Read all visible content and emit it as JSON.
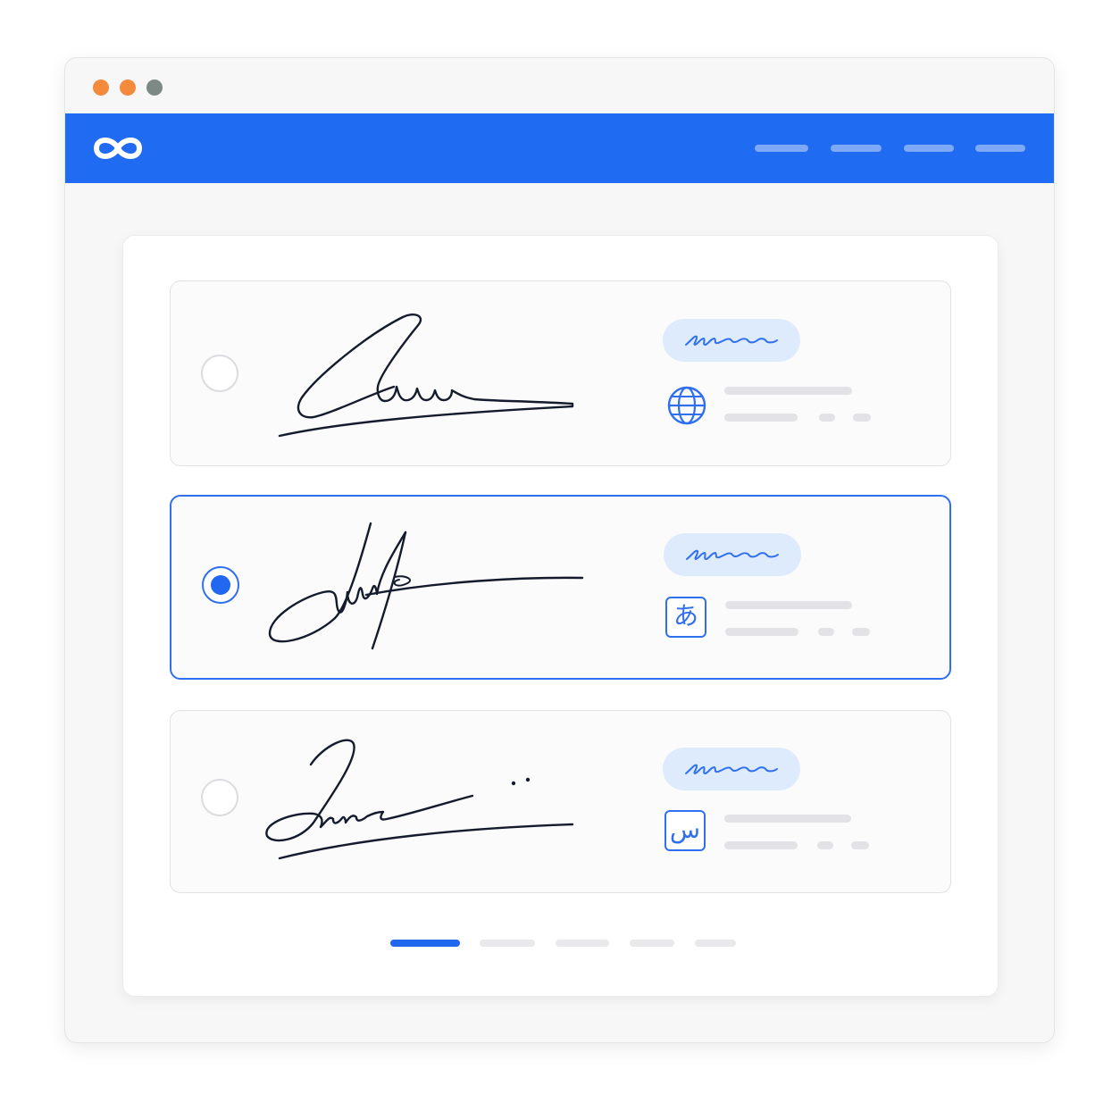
{
  "window": {
    "traffic_lights": [
      {
        "name": "close-dot",
        "color": "#f38a3c"
      },
      {
        "name": "minimize-dot",
        "color": "#f38a3c"
      },
      {
        "name": "maximize-dot",
        "color": "#7c8985"
      }
    ]
  },
  "header": {
    "logo_icon": "infinity-logo",
    "brand_color": "#1f6bf2",
    "nav_links": [
      "placeholder-link-1",
      "placeholder-link-2",
      "placeholder-link-3",
      "placeholder-link-4"
    ]
  },
  "signature_options": [
    {
      "id": "option-1",
      "selected": false,
      "signature_icon": "handwritten-signature",
      "style_badge_icon": "script-squiggle",
      "language_icon": "globe-icon",
      "language_glyph": ""
    },
    {
      "id": "option-2",
      "selected": true,
      "signature_icon": "handwritten-signature",
      "style_badge_icon": "script-squiggle",
      "language_icon": "japanese-char-icon",
      "language_glyph": "あ"
    },
    {
      "id": "option-3",
      "selected": false,
      "signature_icon": "handwritten-signature",
      "style_badge_icon": "script-squiggle",
      "language_icon": "arabic-char-icon",
      "language_glyph": "س"
    }
  ],
  "pagination": {
    "total": 5,
    "current": 1
  },
  "colors": {
    "accent": "#2167f0",
    "selected_border": "#2f6ff0",
    "badge_bg": "#deebfd",
    "placeholder": "#e3e3e7"
  }
}
